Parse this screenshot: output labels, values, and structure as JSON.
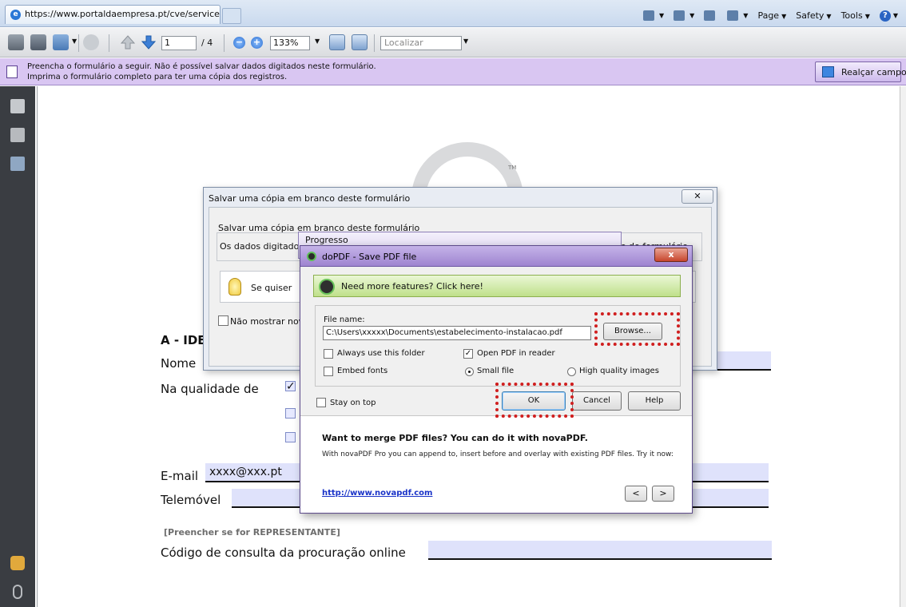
{
  "browser": {
    "tab_title": "https://www.portaldaempresa.pt/cve/services/ba...",
    "commands": [
      "Page",
      "Safety",
      "Tools"
    ]
  },
  "toolbar": {
    "page_current": "1",
    "page_total": "/ 4",
    "zoom": "133%",
    "find_placeholder": "Localizar"
  },
  "banner": {
    "line1": "Preencha o formulário a seguir. Não é possível salvar dados digitados neste formulário.",
    "line2": "Imprima o formulário completo para ter uma cópia dos registros.",
    "highlight_button": "Realçar campos"
  },
  "form": {
    "section_title": "A - IDE",
    "nome_label": "Nome",
    "qualidade_label": "Na qualidade de",
    "checkbox_checked_mark": "✓",
    "email_label": "E-mail",
    "email_value": "xxxx@xxx.pt",
    "telemovel_label": "Telemóvel",
    "representante_note": "[Preencher se for REPRESENTANTE]",
    "codigo_label": "Código de consulta da procuração online"
  },
  "save_dialog": {
    "title": "Salvar uma cópia em branco deste formulário",
    "close_glyph": "✕",
    "heading": "Salvar uma cópia em branco deste formulário",
    "desc_start": "Os dados digitado",
    "desc_end": "se do formulário",
    "tip": "Se quiser",
    "dont_show": "Não mostrar nova"
  },
  "progress_dialog": {
    "title": "Progresso"
  },
  "dopdf_dialog": {
    "title": "doPDF - Save PDF file",
    "close_glyph": "x",
    "promo": "Need more features? Click here!",
    "file_label": "File name:",
    "file_value": "C:\\Users\\xxxxx\\Documents\\estabelecimento-instalacao.pdf",
    "browse": "Browse...",
    "always_use_folder": "Always use this folder",
    "open_in_reader": "Open PDF in reader",
    "open_in_reader_checked": "✓",
    "embed_fonts": "Embed fonts",
    "small_file": "Small file",
    "high_quality": "High quality images",
    "stay_on_top": "Stay on top",
    "ok": "OK",
    "cancel": "Cancel",
    "help": "Help",
    "merge_title": "Want to merge PDF files? You can do it with novaPDF.",
    "merge_desc": "With novaPDF Pro you can append to, insert before and overlay with existing PDF files. Try it now:",
    "link": "http://www.novapdf.com",
    "prev": "<",
    "next": ">"
  },
  "logo": {
    "tm": "TM"
  },
  "icons": {
    "toolbar": [
      "print-icon",
      "save-icon",
      "share-icon",
      "comment-icon",
      "arrow-up-icon",
      "arrow-down-icon",
      "zoom-out-icon",
      "zoom-in-icon",
      "fit-page-icon",
      "fullscreen-icon"
    ],
    "nav": [
      "pages-icon",
      "attachments-icon",
      "sign-icon",
      "comment-bubbles-icon",
      "paperclip-icon"
    ]
  },
  "colors": {
    "banner": "#d9c6f2",
    "field_fill": "#dfe2fb",
    "annotation_red": "#d01f1f",
    "promo_green": "#bfe08a",
    "link_blue": "#1a33c8"
  }
}
